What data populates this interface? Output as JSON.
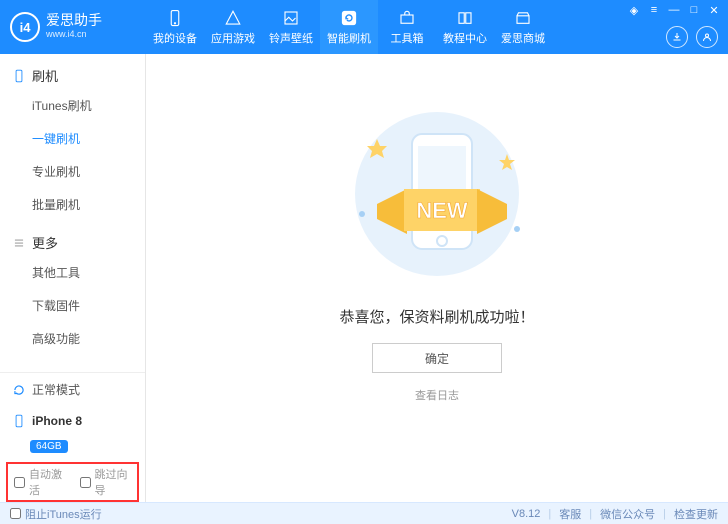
{
  "app": {
    "name": "爱思助手",
    "url": "www.i4.cn",
    "logo_letters": "i4"
  },
  "nav": {
    "items": [
      {
        "label": "我的设备"
      },
      {
        "label": "应用游戏"
      },
      {
        "label": "铃声壁纸"
      },
      {
        "label": "智能刷机"
      },
      {
        "label": "工具箱"
      },
      {
        "label": "教程中心"
      },
      {
        "label": "爱思商城"
      }
    ],
    "active_index": 3
  },
  "sidebar": {
    "group1": {
      "title": "刷机",
      "items": [
        "iTunes刷机",
        "一键刷机",
        "专业刷机",
        "批量刷机"
      ],
      "active_index": 1
    },
    "group2": {
      "title": "更多",
      "items": [
        "其他工具",
        "下载固件",
        "高级功能"
      ]
    },
    "mode": "正常模式",
    "device": "iPhone 8",
    "storage": "64GB",
    "opt_auto": "自动激活",
    "opt_skip": "跳过向导"
  },
  "main": {
    "banner_word": "NEW",
    "success": "恭喜您，保资料刷机成功啦！",
    "ok": "确定",
    "log": "查看日志"
  },
  "footer": {
    "block_itunes": "阻止iTunes运行",
    "version": "V8.12",
    "links": [
      "客服",
      "微信公众号",
      "检查更新"
    ]
  }
}
